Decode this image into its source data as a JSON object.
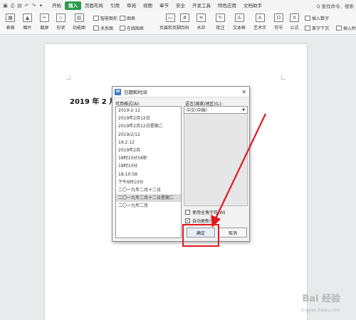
{
  "menu": {
    "tabs": [
      "开始",
      "插入",
      "页面布局",
      "引用",
      "审阅",
      "视图",
      "章节",
      "安全",
      "开发工具",
      "特色应用",
      "文档助手"
    ],
    "active_tab": "插入",
    "right_text": "Q 查找命令、搜索",
    "accent_color": "#2e9b4f"
  },
  "toolbar": {
    "table": "表格",
    "picture": "图片",
    "screenshot": "截屏",
    "shape": "形状",
    "function_chart": "功能图",
    "smart_graphic": "智能图形",
    "chart": "图表",
    "relationship": "关系图",
    "online_chart": "在线图表",
    "header_footer": "页眉和页脚",
    "page_number": "页码",
    "watermark": "水印",
    "comment": "批注",
    "textbox": "文本框",
    "wordart": "艺术字",
    "symbol": "符号",
    "formula": "公式",
    "insert_number": "插入数字",
    "first_letter": "首字下沉",
    "insert_attachment": "插入附件"
  },
  "document": {
    "text": "2019 年 2 月"
  },
  "dialog": {
    "title": "日期和时间",
    "icon_label": "W",
    "available_formats_label": "可用格式(A):",
    "formats": [
      "2019-2-12",
      "2019年2月12日",
      "2019年2月12日星期二",
      "2019/2/12",
      "19.2.12",
      "2019年2月",
      "18时10分58秒",
      "18时10分",
      "18:10:58",
      "下午6时10分",
      "二〇一九年二月十二日",
      "二〇一九年二月十二日星期二",
      "二〇一九年二月"
    ],
    "selected_format_index": 11,
    "language_label": "语言(国家/地区)(L):",
    "language_value": "中文(中国)",
    "use_fullwidth_label": "使用全角字符(W)",
    "use_fullwidth_checked": false,
    "auto_update_label": "自动更新(U)",
    "auto_update_checked": true,
    "ok_label": "确定",
    "cancel_label": "取消"
  },
  "annotation": {
    "color": "#e0191e"
  },
  "watermark": {
    "text": "Bai 经验",
    "sub": "jingyan.baidu.com"
  }
}
